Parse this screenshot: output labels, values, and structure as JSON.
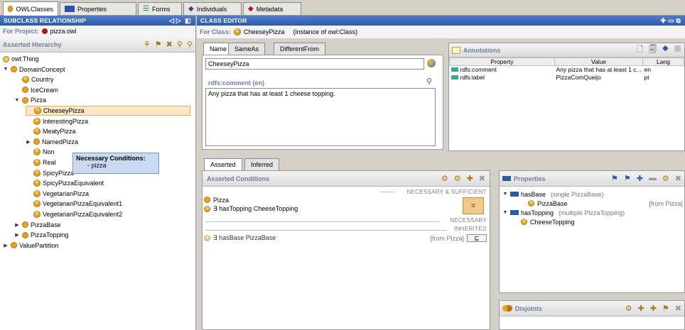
{
  "tabs": [
    {
      "label": "OWLClasses",
      "color": "#e8a21c",
      "active": true
    },
    {
      "label": "Properties",
      "color": "#3050b0",
      "active": false
    },
    {
      "label": "Forms",
      "color": "#2a8a2a",
      "active": false
    },
    {
      "label": "Individuals",
      "color": "#6a2a7a",
      "active": false
    },
    {
      "label": "Metadata",
      "color": "#b01818",
      "active": false
    }
  ],
  "left": {
    "header": "SUBCLASS RELATIONSHIP",
    "project_label": "For Project:",
    "project_name": "pizza.owl",
    "hierarchy_title": "Asserted Hierarchy",
    "tree": [
      {
        "label": "owl:Thing",
        "depth": 0,
        "toggle": "",
        "icon": "thing"
      },
      {
        "label": "DomainConcept",
        "depth": 0,
        "toggle": "▼",
        "icon": "class"
      },
      {
        "label": "Country",
        "depth": 1,
        "toggle": "",
        "icon": "eq"
      },
      {
        "label": "IceCream",
        "depth": 1,
        "toggle": "",
        "icon": "class"
      },
      {
        "label": "Pizza",
        "depth": 1,
        "toggle": "▼",
        "icon": "class"
      },
      {
        "label": "CheeseyPizza",
        "depth": 2,
        "toggle": "",
        "icon": "eq",
        "selected": true
      },
      {
        "label": "InterestingPizza",
        "depth": 2,
        "toggle": "",
        "icon": "eq"
      },
      {
        "label": "MeatyPizza",
        "depth": 2,
        "toggle": "",
        "icon": "eq"
      },
      {
        "label": "NamedPizza",
        "depth": 2,
        "toggle": "▶",
        "icon": "class"
      },
      {
        "label": "Non",
        "depth": 2,
        "toggle": "",
        "icon": "eq"
      },
      {
        "label": "Real",
        "depth": 2,
        "toggle": "",
        "icon": "eq"
      },
      {
        "label": "SpicyPizza",
        "depth": 2,
        "toggle": "",
        "icon": "eq"
      },
      {
        "label": "SpicyPizzaEquivalent",
        "depth": 2,
        "toggle": "",
        "icon": "eq"
      },
      {
        "label": "VegetarianPizza",
        "depth": 2,
        "toggle": "",
        "icon": "eq"
      },
      {
        "label": "VegetarianPizzaEquivalent1",
        "depth": 2,
        "toggle": "",
        "icon": "eq"
      },
      {
        "label": "VegetarianPizzaEquivalent2",
        "depth": 2,
        "toggle": "",
        "icon": "eq"
      },
      {
        "label": "PizzaBase",
        "depth": 1,
        "toggle": "▶",
        "icon": "class"
      },
      {
        "label": "PizzaTopping",
        "depth": 1,
        "toggle": "▶",
        "icon": "class"
      },
      {
        "label": "ValuePartition",
        "depth": 0,
        "toggle": "▶",
        "icon": "class"
      }
    ],
    "tooltip": {
      "title": "Necessary Conditions:",
      "line": "- pizza"
    }
  },
  "editor": {
    "header": "CLASS EDITOR",
    "for_class_label": "For Class:",
    "class_name": "CheeseyPizza",
    "instance_of": "(instance of owl:Class)",
    "name_tabs": [
      "Name",
      "SameAs",
      "DifferentFrom"
    ],
    "name_value": "CheeseyPizza",
    "comment_label": "rdfs:comment (en)",
    "comment_text": "Any pizza that has at least 1 cheese topping.",
    "annotations": {
      "title": "Annotations",
      "columns": [
        "Property",
        "Value",
        "Lang"
      ],
      "rows": [
        {
          "property": "rdfs:comment",
          "value": "Any pizza that has at least 1 c...",
          "lang": "en"
        },
        {
          "property": "rdfs:label",
          "value": "PizzaComQueijo",
          "lang": "pt"
        }
      ]
    },
    "condition_tabs": [
      "Asserted",
      "Inferred"
    ],
    "conditions": {
      "title": "Asserted Conditions",
      "nec_suff": "NECESSARY & SUFFICIENT",
      "necessary": "NECESSARY",
      "inherited": "INHERITED",
      "ns_items": [
        "Pizza",
        "∃ hasTopping CheeseTopping"
      ],
      "inherited_items": [
        {
          "text": "∃ hasBase PizzaBase",
          "from": "[from Pizza]"
        }
      ],
      "eq_symbol": "=",
      "subset_symbol": "⊑"
    },
    "properties": {
      "title": "Properties",
      "items": [
        {
          "name": "hasBase",
          "desc": "(single PizzaBase)",
          "child": "PizzaBase",
          "from": "[from Pizza]"
        },
        {
          "name": "hasTopping",
          "desc": "(multiple PizzaTopping)",
          "child": "CheeseTopping",
          "from": ""
        }
      ]
    },
    "disjoints": {
      "title": "Disjoints"
    }
  }
}
